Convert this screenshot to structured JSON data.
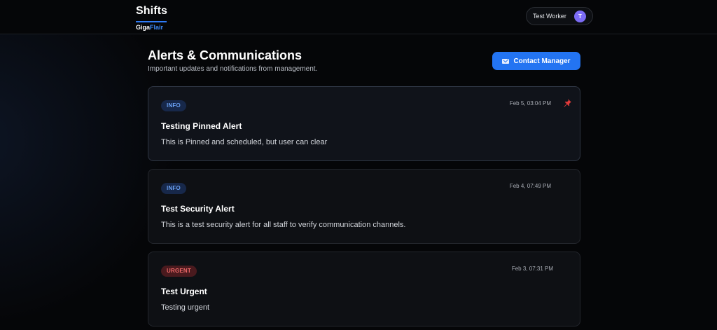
{
  "header": {
    "brand_title": "Shifts",
    "brand_sub_main": "Giga",
    "brand_sub_accent": "Flair",
    "user_name": "Test Worker",
    "user_initial": "T"
  },
  "page": {
    "title": "Alerts & Communications",
    "subtitle": "Important updates and notifications from management.",
    "contact_label": "Contact Manager"
  },
  "alerts": [
    {
      "level": "INFO",
      "time": "Feb 5, 03:04 PM",
      "title": "Testing Pinned Alert",
      "body": "This is Pinned and scheduled, but user can clear",
      "pinned": true
    },
    {
      "level": "INFO",
      "time": "Feb 4, 07:49 PM",
      "title": "Test Security Alert",
      "body": "This is a test security alert for all staff to verify communication channels.",
      "pinned": false
    },
    {
      "level": "URGENT",
      "time": "Feb 3, 07:31 PM",
      "title": "Test Urgent",
      "body": "Testing urgent",
      "pinned": false
    }
  ],
  "colors": {
    "accent": "#2374f2",
    "info_badge": "#6aa0f2",
    "urgent_badge": "#f06a6a",
    "pin": "#e03a3a"
  }
}
